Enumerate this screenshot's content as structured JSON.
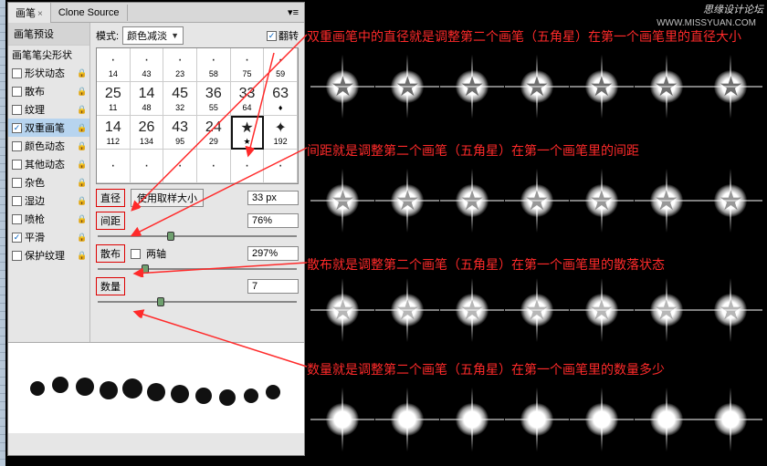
{
  "tabs": {
    "brush": "画笔",
    "clone": "Clone Source"
  },
  "preset_label": "画笔预设",
  "mode_label": "模式:",
  "mode_value": "颜色减淡",
  "flip_label": "翻转",
  "flip_checked": true,
  "sidebar": [
    {
      "label": "画笔笔尖形状",
      "chk": null,
      "lock": false
    },
    {
      "label": "形状动态",
      "chk": false,
      "lock": true
    },
    {
      "label": "散布",
      "chk": false,
      "lock": true
    },
    {
      "label": "纹理",
      "chk": false,
      "lock": true
    },
    {
      "label": "双重画笔",
      "chk": true,
      "lock": true,
      "selected": true
    },
    {
      "label": "颜色动态",
      "chk": false,
      "lock": true
    },
    {
      "label": "其他动态",
      "chk": false,
      "lock": true
    },
    {
      "label": "杂色",
      "chk": false,
      "lock": true
    },
    {
      "label": "湿边",
      "chk": false,
      "lock": true
    },
    {
      "label": "喷枪",
      "chk": false,
      "lock": true
    },
    {
      "label": "平滑",
      "chk": true,
      "lock": true
    },
    {
      "label": "保护纹理",
      "chk": false,
      "lock": true
    }
  ],
  "brush_cells": [
    [
      "·",
      "·",
      "·",
      "·",
      "·",
      "·"
    ],
    [
      "14",
      "43",
      "23",
      "58",
      "75",
      "59"
    ],
    [
      "25",
      "14",
      "45",
      "36",
      "33",
      "63"
    ],
    [
      "11",
      "48",
      "32",
      "55",
      "64",
      "♦"
    ],
    [
      "14",
      "26",
      "43",
      "24",
      "★",
      "✦"
    ],
    [
      "112",
      "134",
      "95",
      "29",
      "★",
      "192"
    ]
  ],
  "selected_brush": {
    "row": 4,
    "col": 4
  },
  "diameter": {
    "label": "直径",
    "btn": "使用取样大小",
    "value": "33 px"
  },
  "spacing": {
    "label": "间距",
    "value": "76%",
    "thumb": 35
  },
  "scatter": {
    "label": "散布",
    "axes_label": "两轴",
    "axes_checked": false,
    "value": "297%",
    "thumb": 22
  },
  "count": {
    "label": "数量",
    "value": "7",
    "thumb": 30
  },
  "annotations": {
    "a1": "双重画笔中的直径就是调整第二个画笔（五角星）在第一个画笔里的直径大小",
    "a2": "间距就是调整第二个画笔（五角星）在第一个画笔里的间距",
    "a3": "散布就是调整第二个画笔（五角星）在第一个画笔里的散落状态",
    "a4": "数量就是调整第二个画笔（五角星）在第一个画笔里的数量多少"
  },
  "watermark": "思缘设计论坛",
  "watermark2": "WWW.MISSYUAN.COM"
}
